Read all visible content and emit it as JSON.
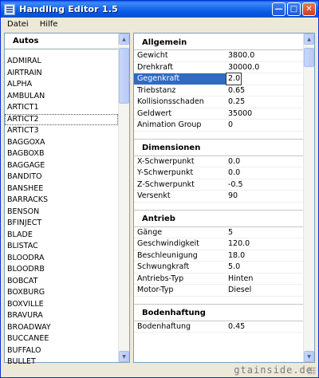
{
  "window": {
    "title": "Handling Editor 1.5",
    "menu": [
      "Datei",
      "Hilfe"
    ],
    "buttons": {
      "minimize": "—",
      "maximize": "□",
      "close": "✕"
    }
  },
  "list": {
    "header": "Autos",
    "selected_index": 5,
    "items": [
      "ADMIRAL",
      "AIRTRAIN",
      "ALPHA",
      "AMBULAN",
      "ARTICT1",
      "ARTICT2",
      "ARTICT3",
      "BAGGOXA",
      "BAGBOXB",
      "BAGGAGE",
      "BANDITO",
      "BANSHEE",
      "BARRACKS",
      "BENSON",
      "BFINJECT",
      "BLADE",
      "BLISTAC",
      "BLOODRA",
      "BLOODRB",
      "BOBCAT",
      "BOXBURG",
      "BOXVILLE",
      "BRAVURA",
      "BROADWAY",
      "BUCCANEE",
      "BUFFALO",
      "BULLET"
    ]
  },
  "properties": {
    "sections": [
      {
        "title": "Allgemein",
        "rows": [
          {
            "name": "Gewicht",
            "value": "3800.0"
          },
          {
            "name": "Drehkraft",
            "value": "30000.0"
          },
          {
            "name": "Gegenkraft",
            "value": "2.0",
            "selected": true
          },
          {
            "name": "Triebstanz",
            "value": "0.65"
          },
          {
            "name": "Kollisionsschaden",
            "value": "0.25"
          },
          {
            "name": "Geldwert",
            "value": "35000"
          },
          {
            "name": "Animation Group",
            "value": "0"
          }
        ]
      },
      {
        "title": "Dimensionen",
        "rows": [
          {
            "name": "X-Schwerpunkt",
            "value": "0.0"
          },
          {
            "name": "Y-Schwerpunkt",
            "value": "0.0"
          },
          {
            "name": "Z-Schwerpunkt",
            "value": "-0.5"
          },
          {
            "name": "Versenkt",
            "value": "90"
          }
        ]
      },
      {
        "title": "Antrieb",
        "rows": [
          {
            "name": "Gänge",
            "value": "5"
          },
          {
            "name": "Geschwindigkeit",
            "value": "120.0"
          },
          {
            "name": "Beschleunigung",
            "value": "18.0"
          },
          {
            "name": "Schwungkraft",
            "value": "5.0"
          },
          {
            "name": "Antriebs-Typ",
            "value": "Hinten"
          },
          {
            "name": "Motor-Typ",
            "value": "Diesel"
          }
        ]
      },
      {
        "title": "Bodenhaftung",
        "rows": [
          {
            "name": "Bodenhaftung",
            "value": "0.45"
          }
        ]
      }
    ]
  },
  "watermark": "gtainside.de",
  "colors": {
    "selection": "#316ac5",
    "titlebar": "#0a5ee8",
    "window_bg": "#ece9d8"
  }
}
